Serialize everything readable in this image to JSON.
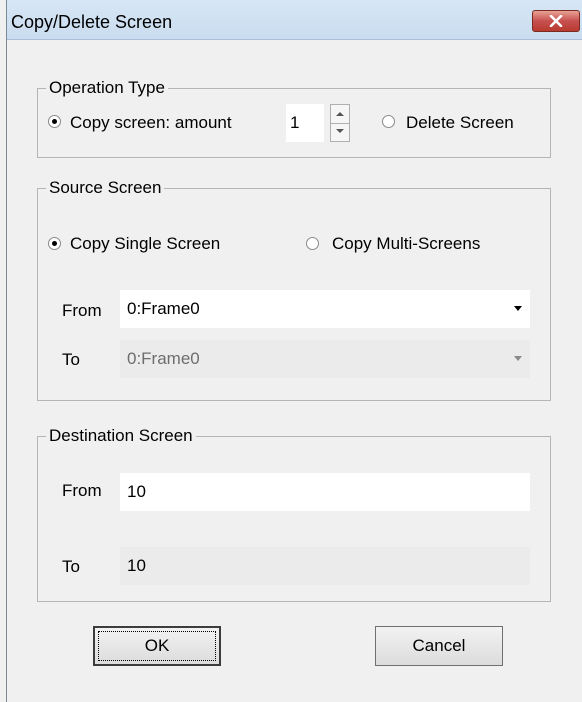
{
  "window": {
    "title": "Copy/Delete Screen"
  },
  "operation_type": {
    "legend": "Operation Type",
    "copy_label": "Copy screen: amount",
    "amount": "1",
    "delete_label": "Delete Screen",
    "selected": "copy"
  },
  "source_screen": {
    "legend": "Source Screen",
    "single_label": "Copy Single Screen",
    "multi_label": "Copy Multi-Screens",
    "selected": "single",
    "from_label": "From",
    "from_value": "0:Frame0",
    "to_label": "To",
    "to_value": "0:Frame0"
  },
  "destination_screen": {
    "legend": "Destination Screen",
    "from_label": "From",
    "from_value": "10",
    "to_label": "To",
    "to_value": "10"
  },
  "buttons": {
    "ok": "OK",
    "cancel": "Cancel"
  },
  "icons": {
    "close": "close-icon"
  },
  "colors": {
    "close_button": "#c75050",
    "titlebar": "#c9dcef",
    "window_bg": "#f0f0f0"
  }
}
